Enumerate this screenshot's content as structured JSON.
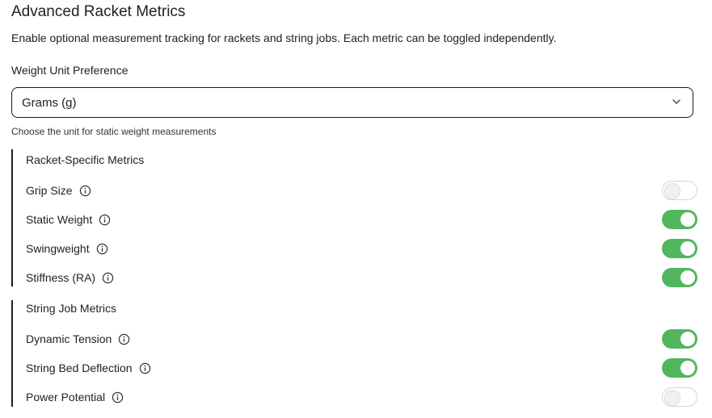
{
  "header": {
    "title": "Advanced Racket Metrics",
    "description": "Enable optional measurement tracking for rackets and string jobs. Each metric can be toggled independently."
  },
  "weight_unit": {
    "label": "Weight Unit Preference",
    "selected": "Grams (g)",
    "hint": "Choose the unit for static weight measurements"
  },
  "racket_metrics": {
    "heading": "Racket-Specific Metrics",
    "items": [
      {
        "label": "Grip Size",
        "enabled": false
      },
      {
        "label": "Static Weight",
        "enabled": true
      },
      {
        "label": "Swingweight",
        "enabled": true
      },
      {
        "label": "Stiffness (RA)",
        "enabled": true
      }
    ]
  },
  "string_metrics": {
    "heading": "String Job Metrics",
    "items": [
      {
        "label": "Dynamic Tension",
        "enabled": true
      },
      {
        "label": "String Bed Deflection",
        "enabled": true
      },
      {
        "label": "Power Potential",
        "enabled": false
      }
    ]
  },
  "colors": {
    "toggle_on": "#52b65e",
    "toggle_off": "#ffffff",
    "group_border": "#1e1e1e"
  },
  "icons": {
    "info": "info-circle-icon",
    "select": "chevron-down-icon"
  }
}
